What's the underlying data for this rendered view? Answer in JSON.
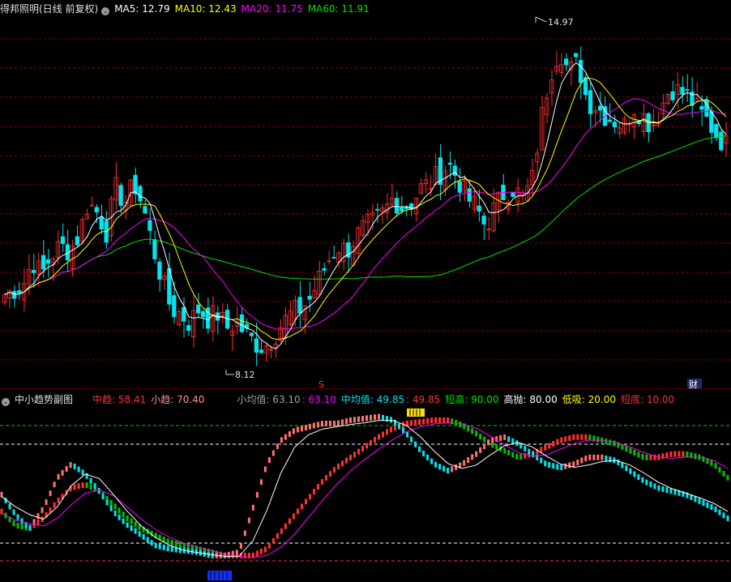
{
  "header": {
    "title": "得邦照明(日线 前复权)",
    "ma5_label": "MA5: 12.79",
    "ma10_label": "MA10: 12.43",
    "ma20_label": "MA20: 11.75",
    "ma60_label": "MA60: 11.91"
  },
  "sub_header": {
    "title": "中小趋势副图",
    "mid_trend": "中趋: 58.41",
    "small_trend": "小趋: 70.40",
    "small_avg": "小均值: 63.10",
    "small_avg2": ": 63.10",
    "mid_avg": "中均值: 49.85",
    "mid_avg2": ": 49.85",
    "short_high": "短高: 90.00",
    "high_sell": "高抛: 80.00",
    "low_buy": "低吸: 20.00",
    "short_low": "短底: 10.00"
  },
  "annotations": {
    "high_price": "14.97",
    "low_price": "8.12",
    "s_marker": "S",
    "cai_marker": "财"
  },
  "colors": {
    "up": "#ff3030",
    "down": "#00e5ee",
    "ma5": "#ffffff",
    "ma10": "#ffff00",
    "ma20": "#ff00ff",
    "ma60": "#00e000",
    "grid": "#8b0000"
  },
  "chart_data": [
    {
      "type": "candlestick",
      "title": "得邦照明(日线 前复权)",
      "ylim": [
        7.8,
        15.4
      ],
      "high": 14.97,
      "low": 8.12,
      "close": [
        9.6,
        9.7,
        9.8,
        10.3,
        10.0,
        10.4,
        10.6,
        10.5,
        10.8,
        11.5,
        11.3,
        10.9,
        11.8,
        11.5,
        11.9,
        11.4,
        10.6,
        9.9,
        9.3,
        9.2,
        9.0,
        9.3,
        9.1,
        9.2,
        8.9,
        9.0,
        8.8,
        8.6,
        8.5,
        8.7,
        9.0,
        9.2,
        9.3,
        9.5,
        9.9,
        10.3,
        10.6,
        10.5,
        10.8,
        11.0,
        11.1,
        11.3,
        11.6,
        11.4,
        11.5,
        11.8,
        11.9,
        12.1,
        12.3,
        12.0,
        11.6,
        11.4,
        11.0,
        11.4,
        11.7,
        11.8,
        11.6,
        11.9,
        13.2,
        14.2,
        14.7,
        14.2,
        14.4,
        13.6,
        13.5,
        13.3,
        13.2,
        13.1,
        13.5,
        13.3,
        13.1,
        13.5,
        13.9,
        13.8,
        13.7,
        13.4,
        13.2,
        12.9,
        12.7
      ]
    },
    {
      "type": "line",
      "title": "中小趋势副图",
      "ylim": [
        0,
        100
      ],
      "reference_lines": {
        "短高": 90,
        "高抛": 80,
        "低吸": 20,
        "短底": 10
      },
      "series": [
        {
          "name": "中趋",
          "values": [
            38,
            30,
            28,
            34,
            44,
            52,
            54,
            50,
            42,
            34,
            28,
            24,
            20,
            18,
            16,
            14,
            12,
            12,
            12,
            16,
            26,
            36,
            46,
            56,
            64,
            70,
            76,
            82,
            87,
            90,
            91,
            92,
            92,
            89,
            84,
            78,
            74,
            70,
            72,
            76,
            80,
            82,
            82,
            80,
            78,
            74,
            70,
            70,
            72,
            72,
            70,
            66,
            58
          ]
        },
        {
          "name": "小趋",
          "values": [
            48,
            36,
            28,
            40,
            58,
            66,
            60,
            50,
            38,
            30,
            24,
            18,
            16,
            15,
            14,
            12,
            12,
            14,
            40,
            66,
            80,
            86,
            88,
            90,
            90,
            92,
            93,
            94,
            92,
            84,
            74,
            66,
            62,
            66,
            72,
            80,
            82,
            78,
            72,
            66,
            64,
            66,
            70,
            70,
            68,
            62,
            56,
            52,
            50,
            48,
            44,
            40,
            34
          ]
        }
      ]
    }
  ]
}
